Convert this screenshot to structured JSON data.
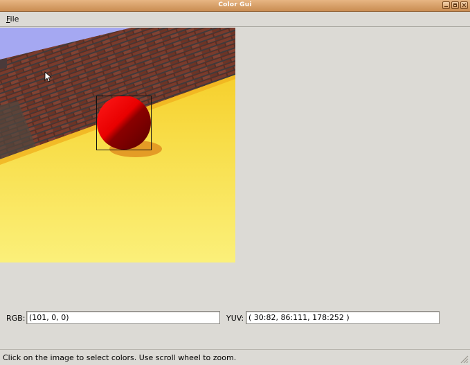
{
  "window": {
    "title": "Color Gui",
    "buttons": [
      "minimize-icon",
      "maximize-icon",
      "close-icon"
    ]
  },
  "menu": {
    "file_mnemonic": "F",
    "file_rest": "ile"
  },
  "viewport": {
    "scene": "simulated robot camera view: brick wall, sky, yellow floor, red ball",
    "selection_box_shown": true
  },
  "fields": {
    "rgb_label": "RGB:",
    "rgb_value": "(101, 0, 0)",
    "yuv_label": "YUV:",
    "yuv_value": "( 30:82, 86:111, 178:252 )"
  },
  "status": {
    "message": "Click on the image to select colors. Use scroll wheel to zoom."
  },
  "colors": {
    "titlebar": "#d49a5f",
    "background": "#dcdad5",
    "ball": "#e00000",
    "floor": "#f7df4a",
    "sky": "#a5a8f2"
  }
}
